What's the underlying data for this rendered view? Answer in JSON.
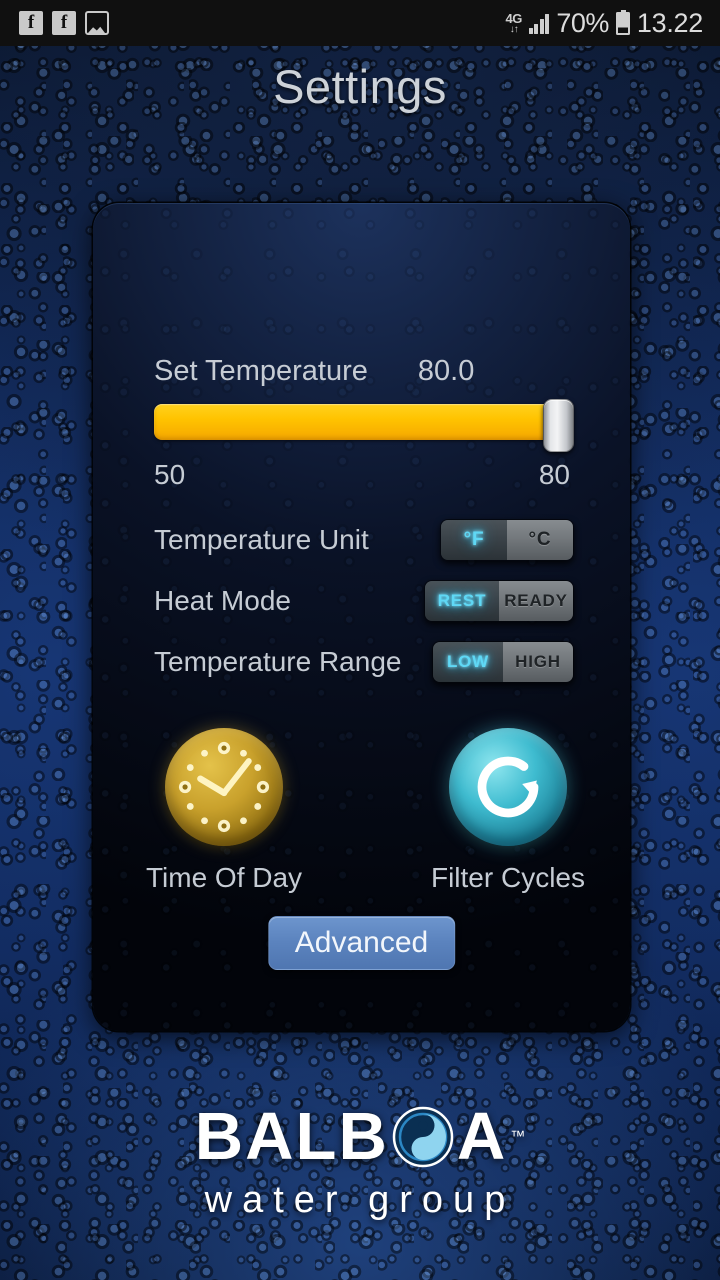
{
  "statusbar": {
    "icons_left": [
      "facebook-icon",
      "facebook-icon",
      "gallery-icon"
    ],
    "fb_glyph": "f",
    "network_type": "4G",
    "data_arrows": "↓↑",
    "battery_percent": "70%",
    "time": "13.22"
  },
  "header": {
    "title": "Settings"
  },
  "panel": {
    "set_temperature": {
      "label": "Set Temperature",
      "value": "80.0",
      "min": "50",
      "max": "80",
      "fill_percent": 100,
      "track_color": "#ffc300",
      "thumb_color": "#e4e6e9"
    },
    "toggles": [
      {
        "name": "temperature-unit",
        "label": "Temperature Unit",
        "options": [
          {
            "text": "°F",
            "selected": true
          },
          {
            "text": "°C",
            "selected": false
          }
        ]
      },
      {
        "name": "heat-mode",
        "label": "Heat Mode",
        "options": [
          {
            "text": "REST",
            "selected": true
          },
          {
            "text": "READY",
            "selected": false
          }
        ]
      },
      {
        "name": "temperature-range",
        "label": "Temperature Range",
        "options": [
          {
            "text": "LOW",
            "selected": true
          },
          {
            "text": "HIGH",
            "selected": false
          }
        ]
      }
    ],
    "circle_buttons": [
      {
        "name": "time-of-day",
        "label": "Time Of Day",
        "icon": "clock-icon",
        "color": "#c9a12c"
      },
      {
        "name": "filter-cycles",
        "label": "Filter Cycles",
        "icon": "refresh-icon",
        "color": "#3fbcd0"
      }
    ],
    "advanced_label": "Advanced"
  },
  "logo": {
    "name_part1": "BALB",
    "name_part2": "A",
    "trademark": "™",
    "subtitle": "water group"
  },
  "colors": {
    "accent_cyan": "#5fd8f5",
    "slider_yellow": "#ffc300",
    "button_blue": "#5b83be",
    "text_light": "#c6ccd4"
  }
}
